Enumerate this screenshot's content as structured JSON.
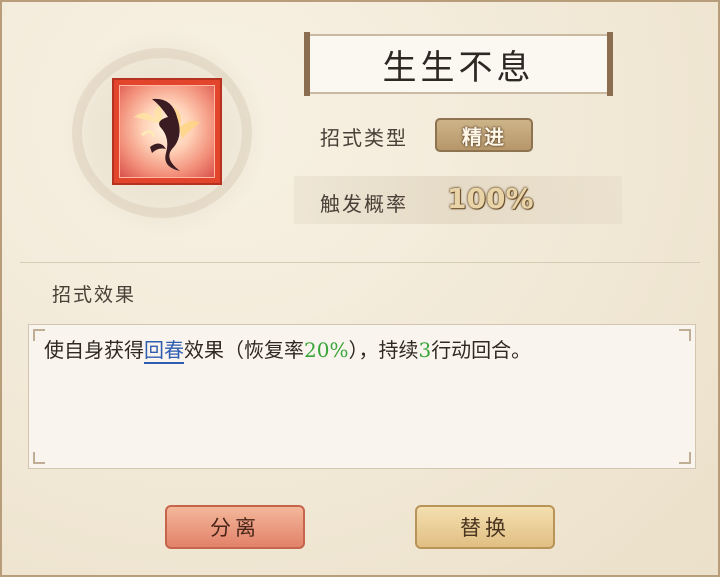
{
  "skill": {
    "name": "生生不息",
    "icon": "flame-leaf-icon",
    "type_label": "招式类型",
    "type_value": "精进",
    "rate_label": "触发概率",
    "rate_value": "100%"
  },
  "effect": {
    "section_label": "招式效果",
    "text_parts": [
      "使自身获得",
      "回春",
      "效果（恢复率",
      "20%",
      "），持续",
      "3",
      "行动回合。"
    ]
  },
  "buttons": {
    "separate": "分离",
    "replace": "替换"
  },
  "colors": {
    "link": "#2f5db1",
    "highlight": "#39a53a",
    "icon_frame": "#e2442c"
  }
}
